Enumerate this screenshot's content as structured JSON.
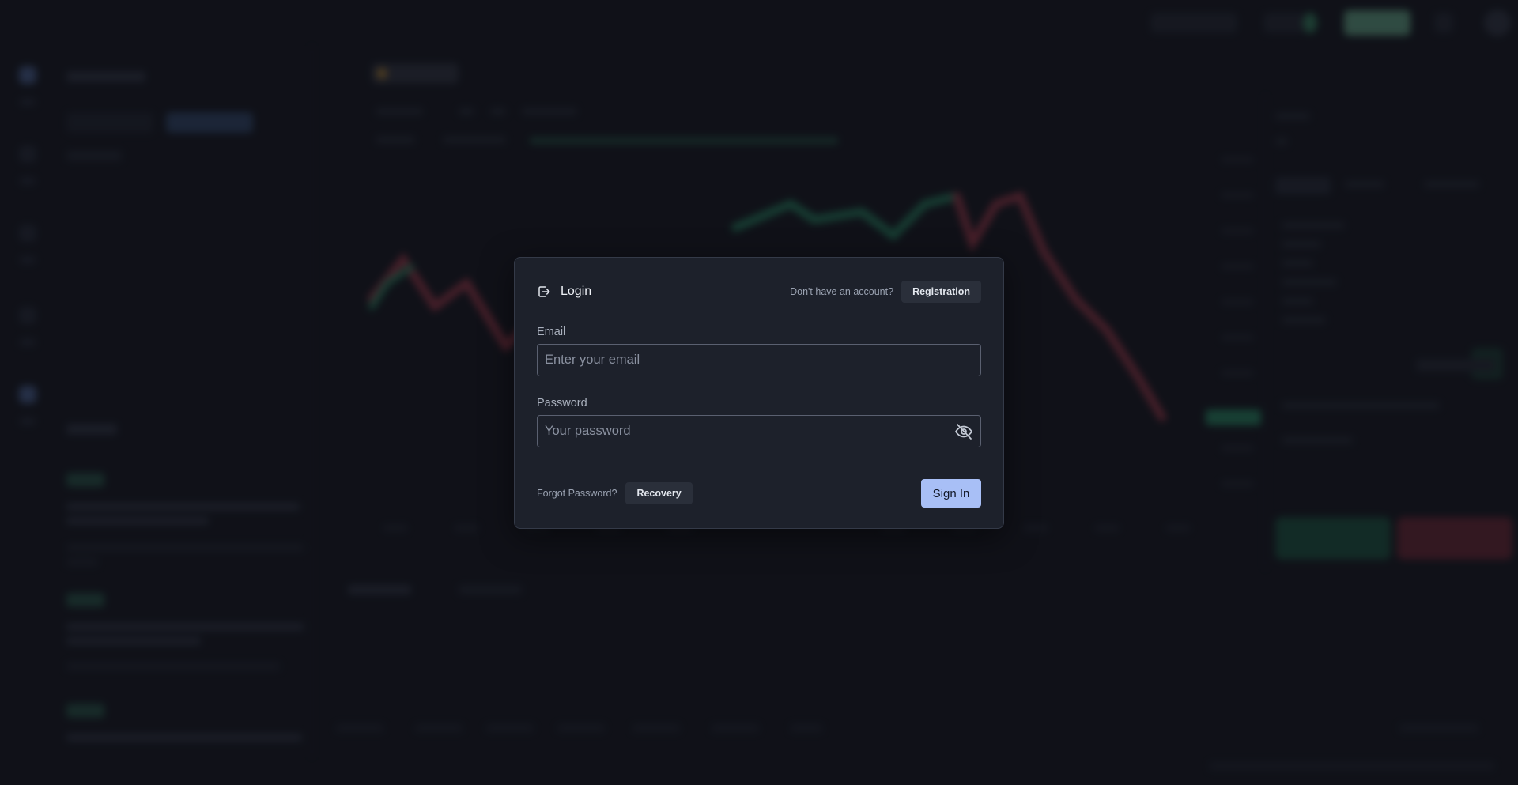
{
  "login": {
    "title": "Login",
    "no_account_text": "Don't have an account?",
    "registration_label": "Registration",
    "email_label": "Email",
    "email_placeholder": "Enter your email",
    "password_label": "Password",
    "password_placeholder": "Your password",
    "forgot_text": "Forgot Password?",
    "recovery_label": "Recovery",
    "signin_label": "Sign In"
  },
  "icons": {
    "login": "login-icon",
    "password_toggle": "eye-off-icon"
  },
  "colors": {
    "modal_bg": "#1d212b",
    "primary_button": "#a8bff6",
    "chip_button": "#2a2f3a",
    "up_candle": "#2fb07a",
    "down_candle": "#d2475a"
  }
}
